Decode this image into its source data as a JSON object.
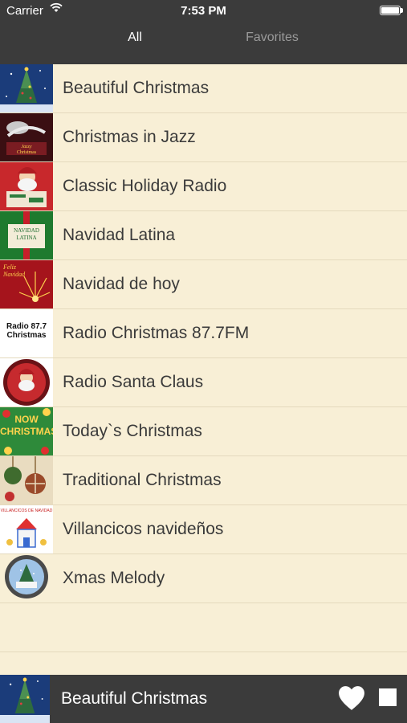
{
  "status": {
    "carrier": "Carrier",
    "time": "7:53 PM"
  },
  "tabs": {
    "all": "All",
    "favorites": "Favorites"
  },
  "stations": [
    {
      "title": "Beautiful Christmas",
      "icon": "christmas-tree-night-thumb"
    },
    {
      "title": "Christmas in Jazz",
      "icon": "jazzy-christmas-thumb"
    },
    {
      "title": "Classic Holiday Radio",
      "icon": "vintage-santa-thumb"
    },
    {
      "title": "Navidad Latina",
      "icon": "navidad-latina-thumb",
      "thumb_text": "NAVIDAD LATINA"
    },
    {
      "title": "Navidad de hoy",
      "icon": "feliz-navidad-thumb",
      "thumb_text": "Feliz Navidad"
    },
    {
      "title": "Radio Christmas 87.7FM",
      "icon": "radio-christmas-logo-thumb",
      "thumb_text": "Radio 87.7 Christmas"
    },
    {
      "title": "Radio Santa Claus",
      "icon": "santa-claus-badge-thumb"
    },
    {
      "title": "Today`s Christmas",
      "icon": "now-christmas-thumb",
      "thumb_text": "NOW CHRISTMAS"
    },
    {
      "title": "Traditional Christmas",
      "icon": "ornaments-thumb"
    },
    {
      "title": "Villancicos navideños",
      "icon": "villancicos-church-thumb",
      "thumb_text": "VILLANCICOS DE NAVIDAD"
    },
    {
      "title": "Xmas Melody",
      "icon": "snow-globe-thumb"
    }
  ],
  "player": {
    "title": "Beautiful Christmas",
    "icon": "christmas-tree-night-thumb"
  },
  "colors": {
    "bar": "#3b3b3b",
    "list_bg": "#f8efd6",
    "divider": "#e4d9bd",
    "text": "#3a3a3a"
  }
}
